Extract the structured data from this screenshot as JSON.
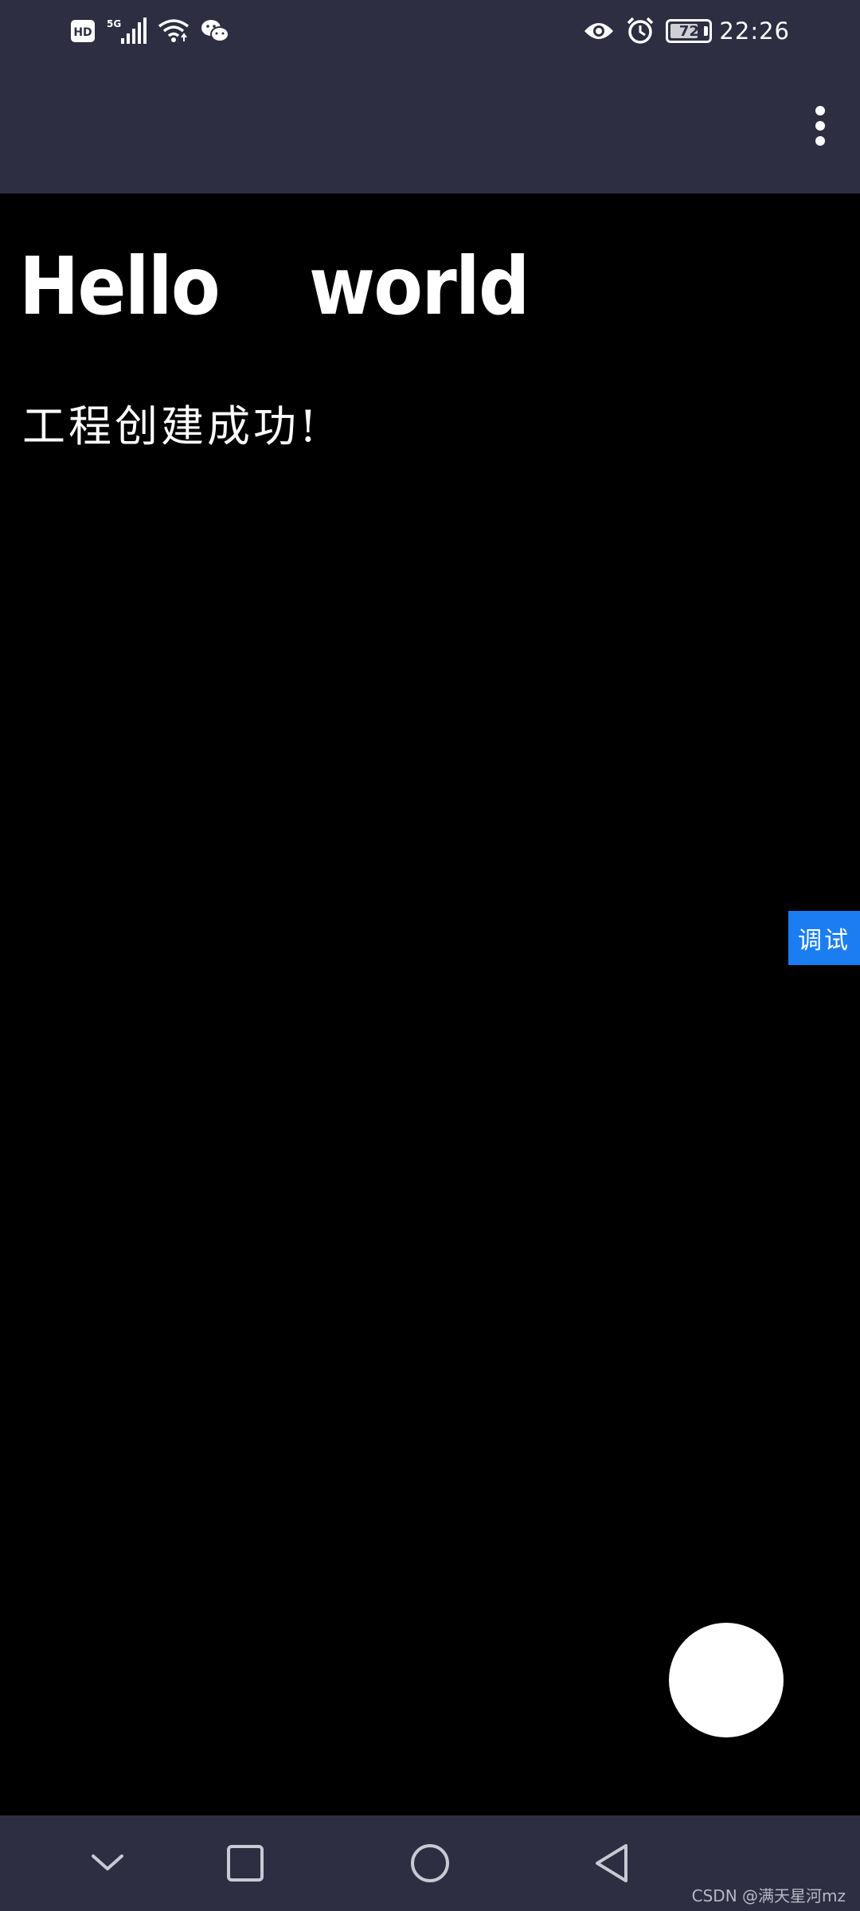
{
  "status_bar": {
    "time": "22:26",
    "battery": "72",
    "battery_level": 0.72,
    "left_icons": [
      "hd-icon",
      "5g-signal-icon",
      "wifi-icon",
      "wechat-icon"
    ],
    "right_icons": [
      "eye-icon",
      "alarm-icon",
      "battery-icon"
    ]
  },
  "app_bar": {
    "menu_icon": "more-vert-icon"
  },
  "main": {
    "heading": "Hello  world",
    "subtitle": "工程创建成功!"
  },
  "debug_tab": {
    "label": "调试",
    "color": "#1a7ef2"
  },
  "fab": {
    "color": "#ffffff"
  },
  "nav_bar": {
    "buttons": [
      "chevron-down-icon",
      "recents-square-icon",
      "home-circle-icon",
      "back-triangle-icon"
    ],
    "watermark": "CSDN @满天星河mz"
  },
  "colors": {
    "bar_bg": "#2d2e42",
    "content_bg": "#000000",
    "text": "#ffffff"
  }
}
